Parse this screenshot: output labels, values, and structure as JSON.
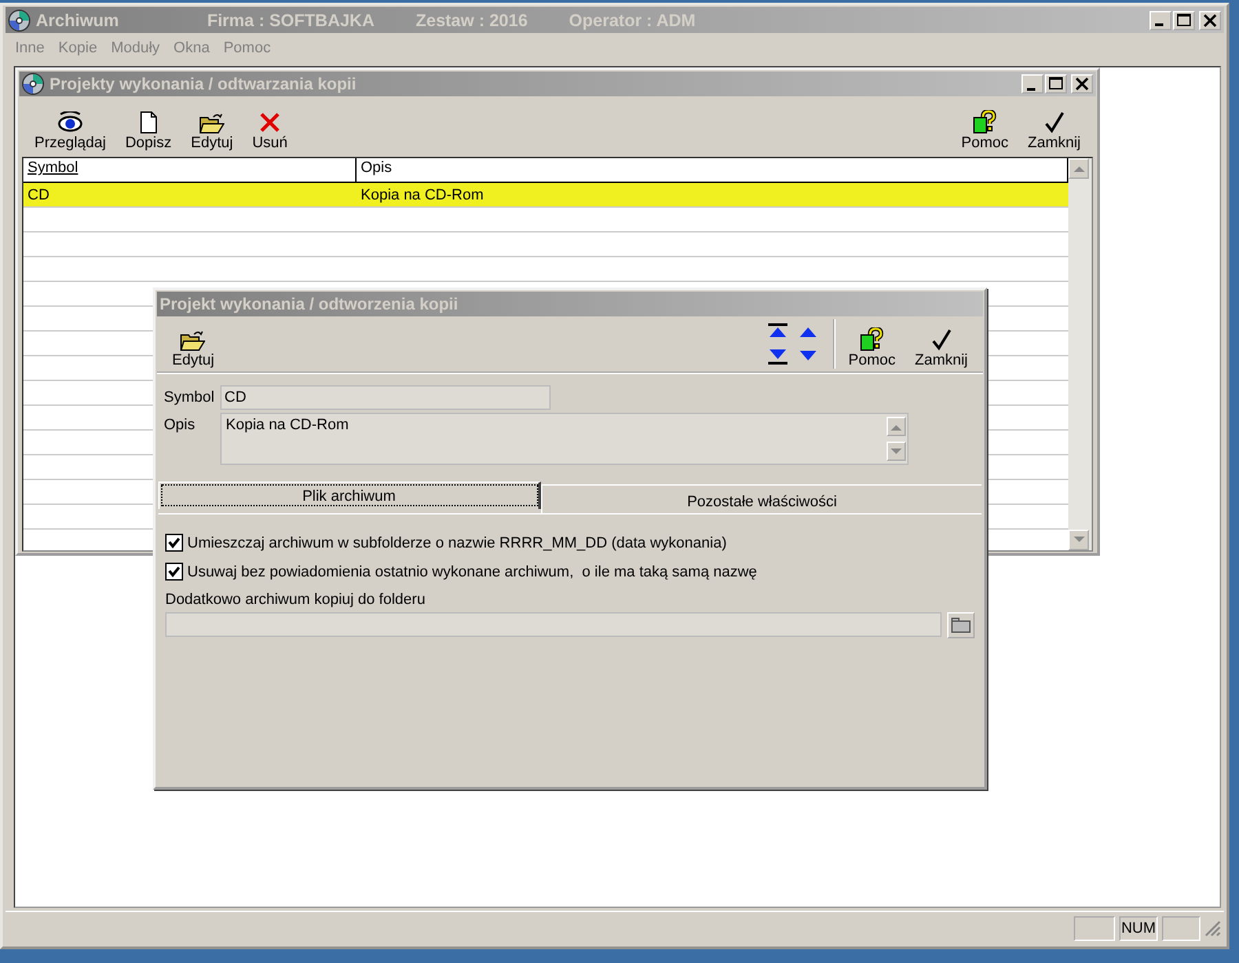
{
  "app_window": {
    "title": "Archiwum",
    "firma": "Firma : SOFTBAJKA",
    "zestaw": "Zestaw : 2016",
    "operator": "Operator : ADM"
  },
  "menu": [
    {
      "label": "Inne",
      "disabled": true
    },
    {
      "label": "Kopie",
      "disabled": true
    },
    {
      "label": "Moduły",
      "disabled": true
    },
    {
      "label": "Okna",
      "disabled": true
    },
    {
      "label": "Pomoc",
      "disabled": true
    }
  ],
  "list_window": {
    "title": "Projekty wykonania / odtwarzania kopii",
    "toolbar": [
      {
        "label": "Przeglądaj",
        "kind": "view"
      },
      {
        "label": "Dopisz",
        "kind": "new"
      },
      {
        "label": "Edytuj",
        "kind": "edit"
      },
      {
        "label": "Usuń",
        "kind": "delete"
      }
    ],
    "toolbar_right": [
      {
        "label": "Pomoc",
        "kind": "help"
      },
      {
        "label": "Zamknij",
        "kind": "close"
      }
    ],
    "columns": [
      "Symbol",
      "Opis"
    ],
    "rows": [
      {
        "symbol": "CD",
        "opis": "Kopia na CD-Rom",
        "selected": true
      }
    ]
  },
  "dialog": {
    "title": "Projekt wykonania / odtworzenia kopii",
    "toolbar": [
      {
        "label": "Edytuj",
        "kind": "edit"
      }
    ],
    "toolbar_right": [
      {
        "label": "Pomoc",
        "kind": "help"
      },
      {
        "label": "Zamknij",
        "kind": "close"
      }
    ],
    "symbol_label": "Symbol",
    "symbol": "CD",
    "opis_label": "Opis",
    "opis": "Kopia na CD-Rom",
    "tabs": [
      {
        "label": "Plik archiwum",
        "selected": true
      },
      {
        "label": "Pozostałe właściwości",
        "selected": false
      }
    ],
    "checkboxes": [
      {
        "label": "Umieszczaj archiwum w subfolderze o nazwie RRRR_MM_DD (data wykonania)",
        "checked": true
      },
      {
        "label": "Usuwaj bez powiadomienia ostatnio wykonane archiwum,  o ile ma taką samą nazwę",
        "checked": true
      }
    ],
    "folder_label": "Dodatkowo archiwum kopiuj do folderu"
  },
  "status_bar": {
    "indicator": "NUM"
  }
}
